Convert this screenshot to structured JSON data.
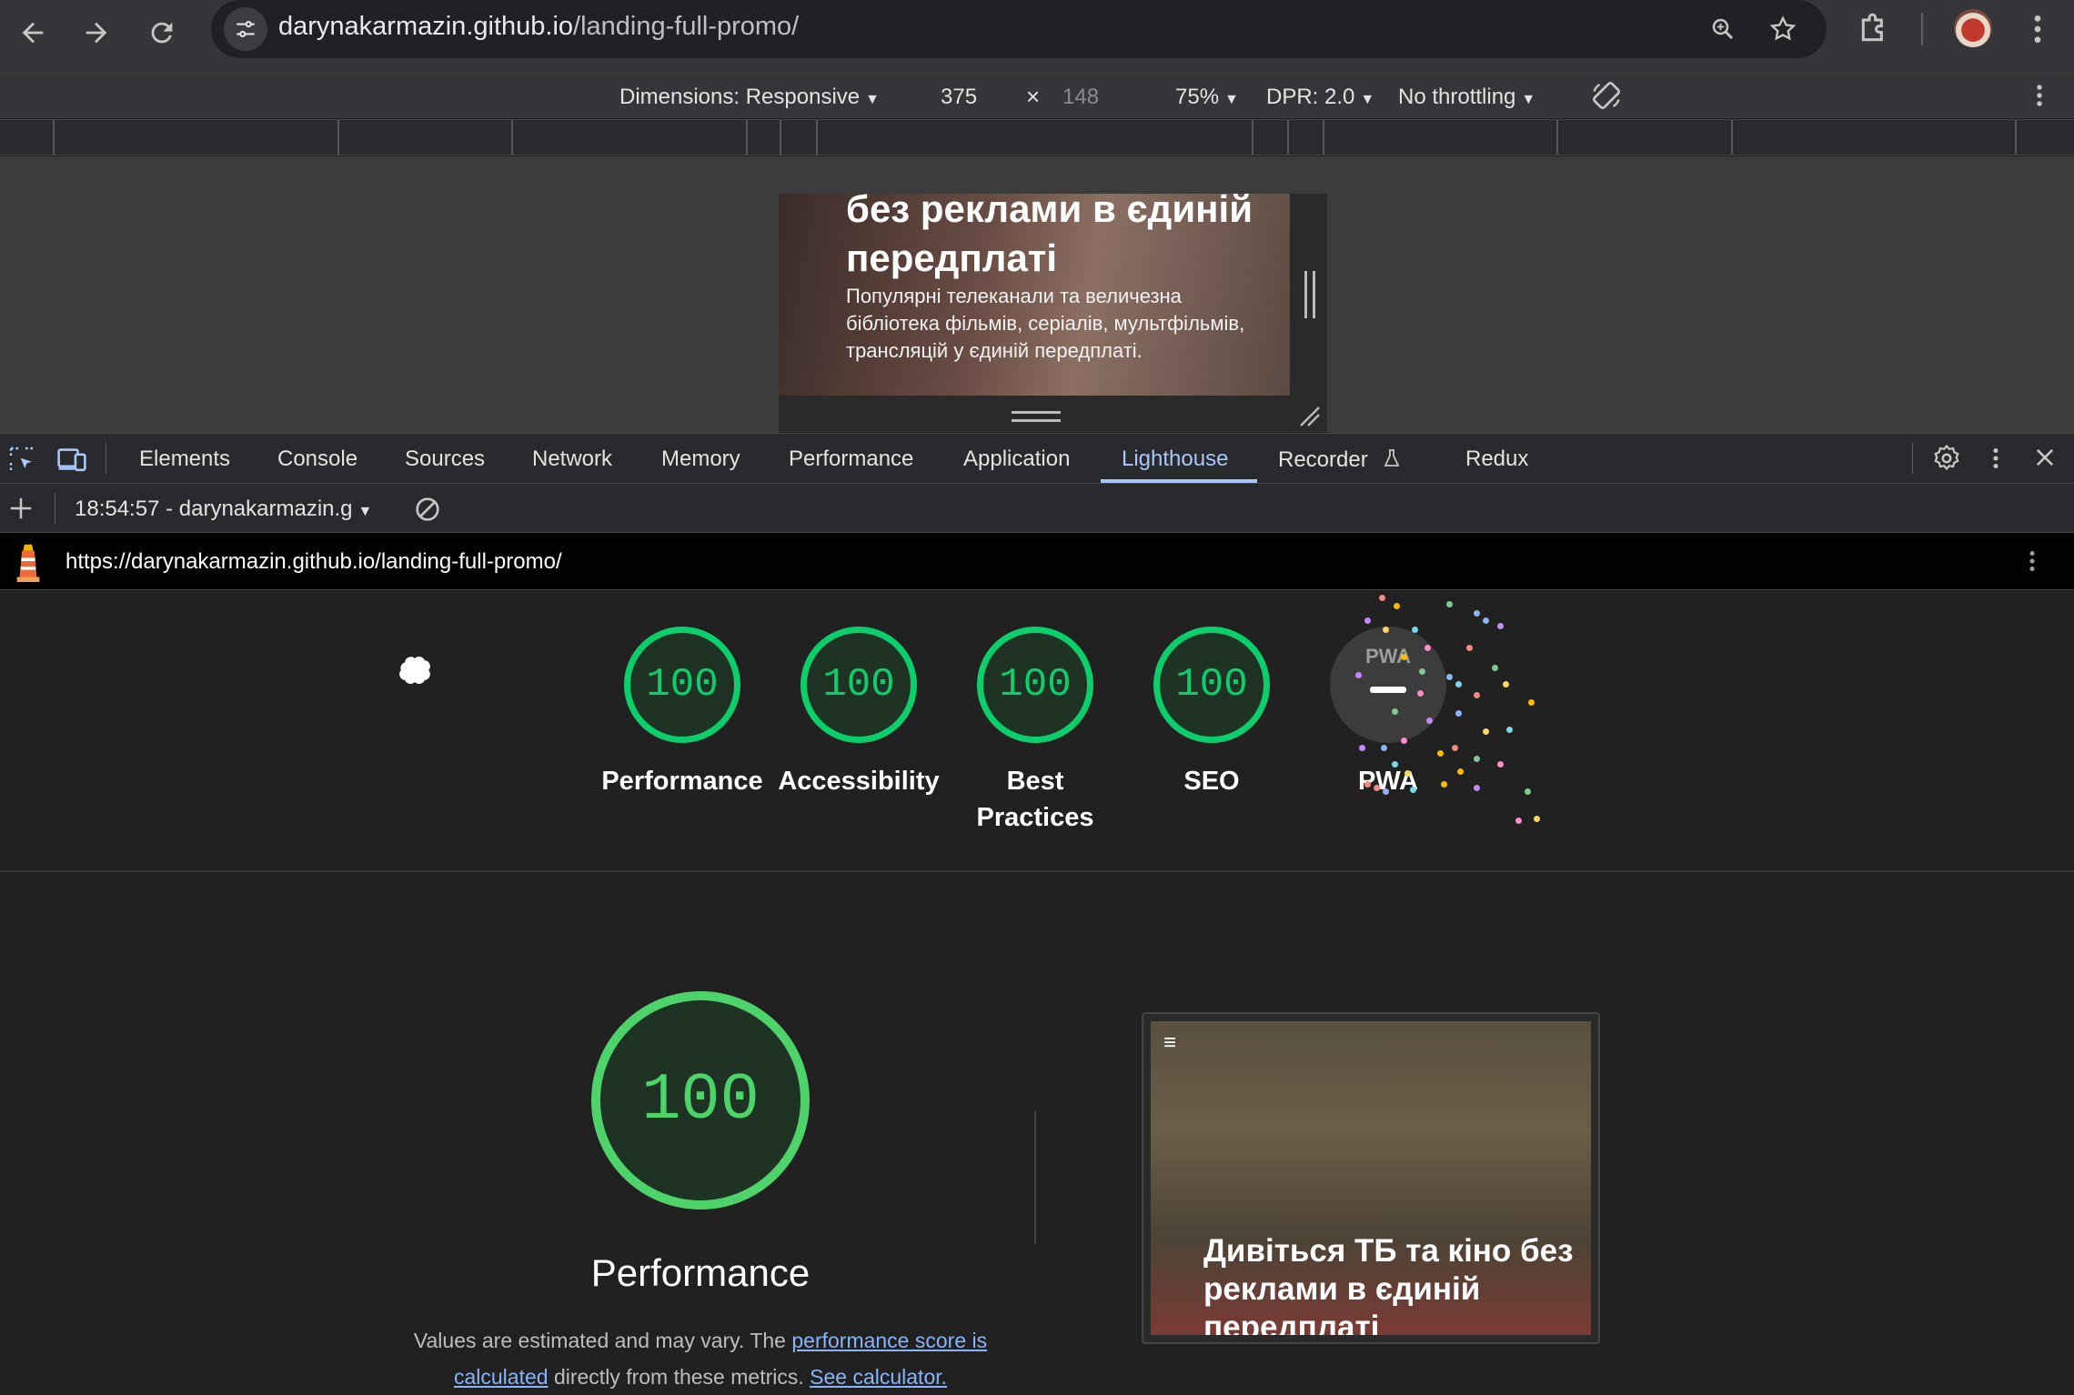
{
  "browser": {
    "url_host": "darynakarmazin.github.io",
    "url_path": "/landing-full-promo/"
  },
  "device_toolbar": {
    "dimensions": "Dimensions: Responsive",
    "width": "375",
    "times": "×",
    "height": "148",
    "zoom": "75%",
    "dpr": "DPR: 2.0",
    "throttling": "No throttling"
  },
  "viewport": {
    "headline": "без реклами в єдиній передплаті",
    "subtext": "Популярні телеканали та величезна бібліотека фільмів, серіалів, мультфільмів, трансляцій у єдиній передплаті."
  },
  "devtools": {
    "tabs": [
      "Elements",
      "Console",
      "Sources",
      "Network",
      "Memory",
      "Performance",
      "Application",
      "Lighthouse",
      "Recorder",
      "Redux"
    ],
    "active_tab": "Lighthouse",
    "report_select": "18:54:57 - darynakarmazin.g",
    "report_url": "https://darynakarmazin.github.io/landing-full-promo/"
  },
  "scores": [
    {
      "label": "Performance",
      "score": "100"
    },
    {
      "label": "Accessibility",
      "score": "100"
    },
    {
      "label": "Best Practices",
      "score": "100"
    },
    {
      "label": "SEO",
      "score": "100"
    }
  ],
  "pwa": {
    "label": "PWA",
    "badge": "PWA"
  },
  "performance_section": {
    "score": "100",
    "title": "Performance",
    "desc_prefix": "Values are estimated and may vary. The ",
    "link1": "performance score is calculated",
    "desc_mid": " directly from these metrics. ",
    "link2": "See calculator."
  },
  "screenshot": {
    "menu": "≡",
    "headline": "Дивіться ТБ та кіно без реклами в єдиній передплаті"
  },
  "colors": {
    "pass": "#0cce6b",
    "link": "#8ab4f8",
    "active_tab": "#a8c7fa"
  }
}
